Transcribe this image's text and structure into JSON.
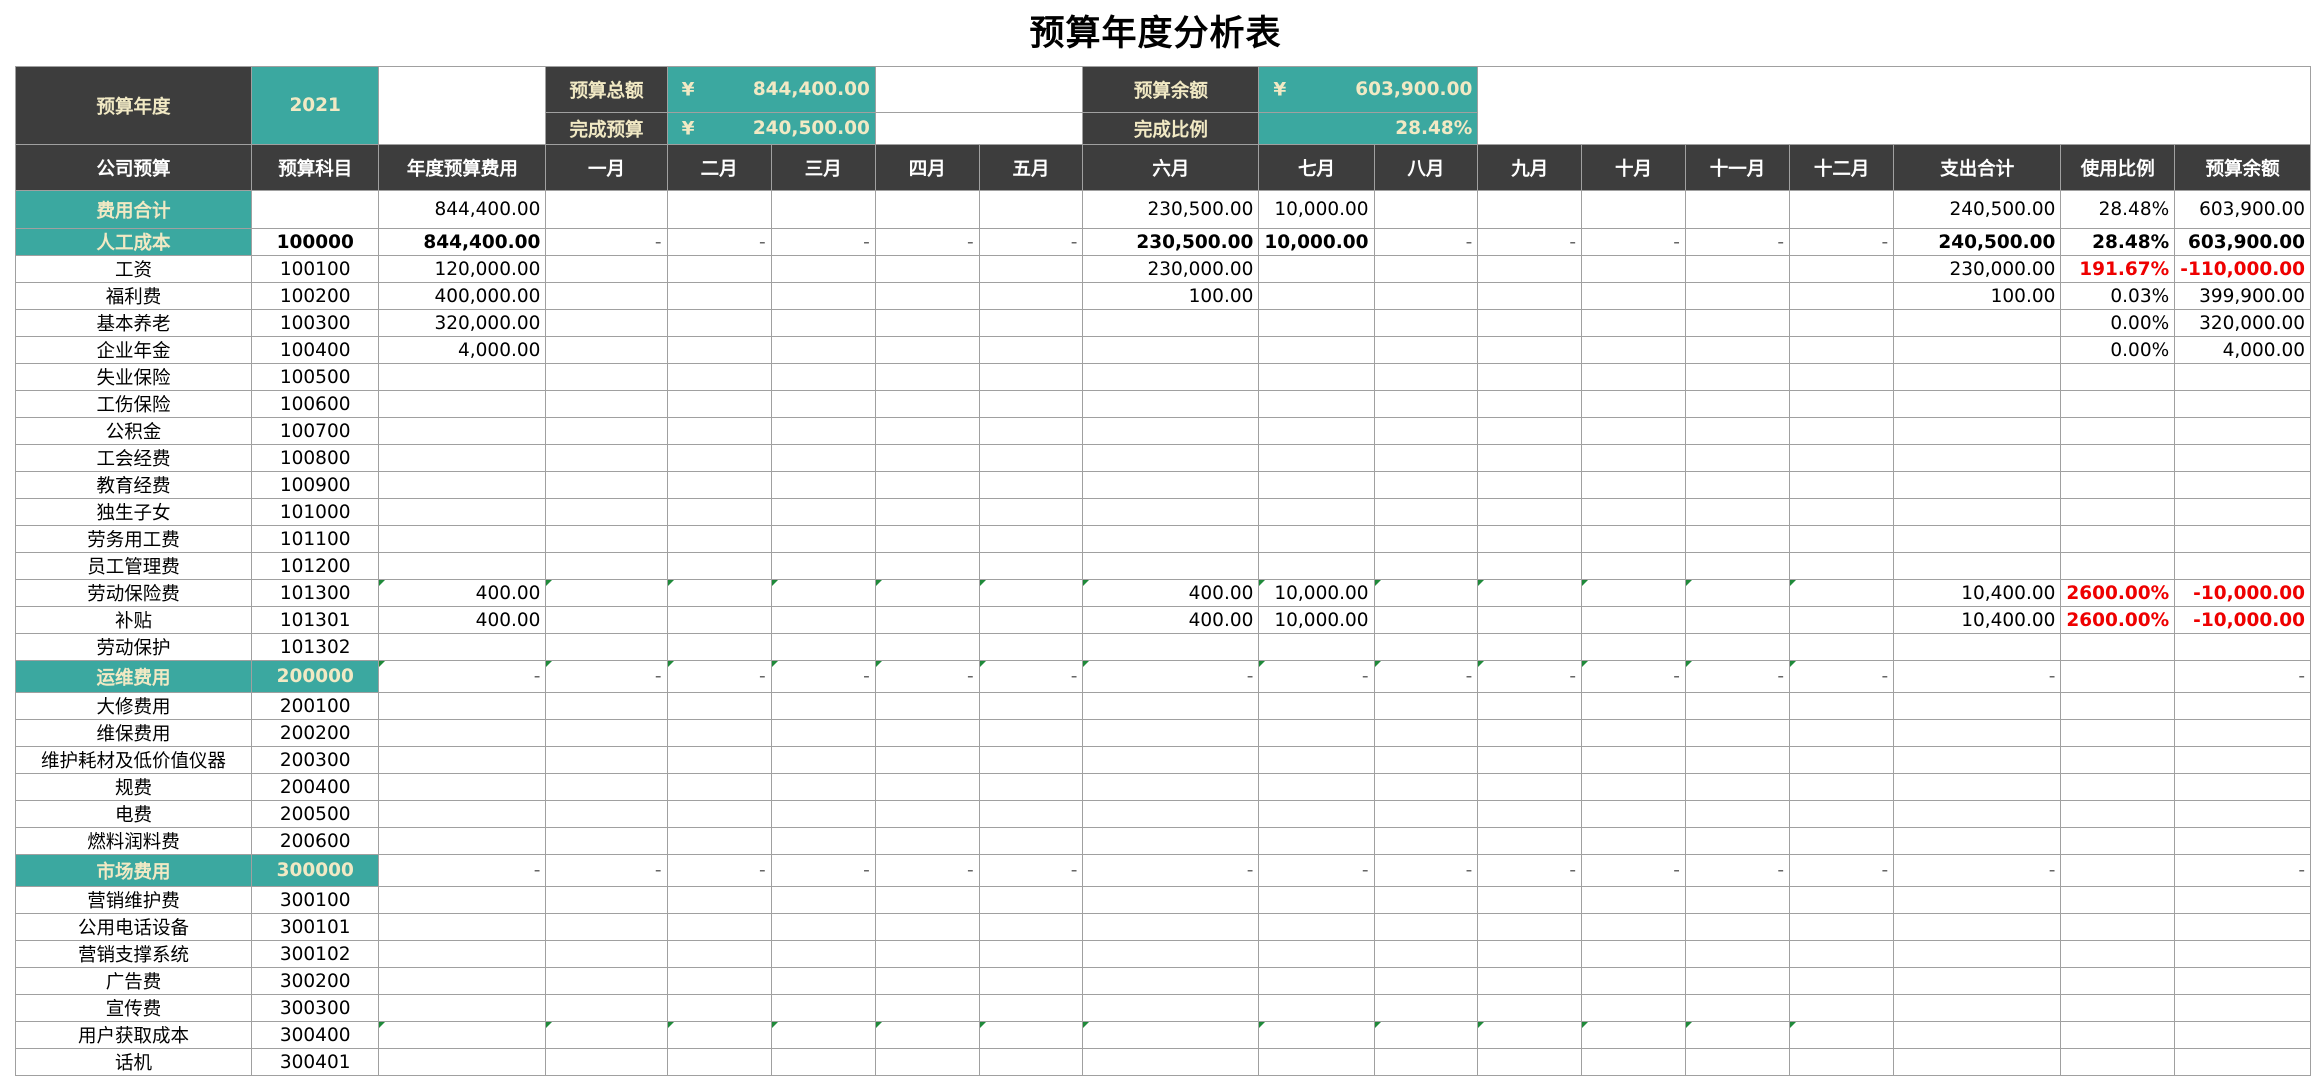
{
  "title": "预算年度分析表",
  "summary": {
    "year_label": "预算年度",
    "year_value": "2021",
    "total_label": "预算总额",
    "total_currency": "¥",
    "total_value": "844,400.00",
    "done_label": "完成预算",
    "done_currency": "¥",
    "done_value": "240,500.00",
    "remain_label": "预算余额",
    "remain_currency": "¥",
    "remain_value": "603,900.00",
    "ratio_label": "完成比例",
    "ratio_value": "28.48%"
  },
  "headers": [
    "公司预算",
    "预算科目",
    "年度预算费用",
    "一月",
    "二月",
    "三月",
    "四月",
    "五月",
    "六月",
    "七月",
    "八月",
    "九月",
    "十月",
    "十一月",
    "十二月",
    "支出合计",
    "使用比例",
    "预算余额"
  ],
  "rows": [
    {
      "type": "group",
      "name": "费用合计",
      "code": "",
      "annual": "844,400.00",
      "m6": "230,500.00",
      "m7": "10,000.00",
      "total": "240,500.00",
      "ratio": "28.48%",
      "remain": "603,900.00"
    },
    {
      "type": "cat",
      "name": "人工成本",
      "code": "100000",
      "annual": "844,400.00",
      "m1": "-",
      "m2": "-",
      "m3": "-",
      "m4": "-",
      "m5": "-",
      "m6": "230,500.00",
      "m7": "10,000.00",
      "m8": "-",
      "m9": "-",
      "m10": "-",
      "m11": "-",
      "m12": "-",
      "total": "240,500.00",
      "ratio": "28.48%",
      "remain": "603,900.00"
    },
    {
      "type": "item",
      "name": "工资",
      "code": "100100",
      "annual": "120,000.00",
      "m6": "230,000.00",
      "total": "230,000.00",
      "ratio": "191.67%",
      "remain": "-110,000.00",
      "neg": true
    },
    {
      "type": "item",
      "name": "福利费",
      "code": "100200",
      "annual": "400,000.00",
      "m6": "100.00",
      "total": "100.00",
      "ratio": "0.03%",
      "remain": "399,900.00"
    },
    {
      "type": "item",
      "name": "基本养老",
      "code": "100300",
      "annual": "320,000.00",
      "ratio": "0.00%",
      "remain": "320,000.00"
    },
    {
      "type": "item",
      "name": "企业年金",
      "code": "100400",
      "annual": "4,000.00",
      "ratio": "0.00%",
      "remain": "4,000.00"
    },
    {
      "type": "item",
      "name": "失业保险",
      "code": "100500"
    },
    {
      "type": "item",
      "name": "工伤保险",
      "code": "100600"
    },
    {
      "type": "item",
      "name": "公积金",
      "code": "100700"
    },
    {
      "type": "item",
      "name": "工会经费",
      "code": "100800"
    },
    {
      "type": "item",
      "name": "教育经费",
      "code": "100900"
    },
    {
      "type": "item",
      "name": "独生子女",
      "code": "101000"
    },
    {
      "type": "item",
      "name": "劳务用工费",
      "code": "101100"
    },
    {
      "type": "item",
      "name": "员工管理费",
      "code": "101200"
    },
    {
      "type": "item",
      "name": "劳动保险费",
      "code": "101300",
      "annual": "400.00",
      "m6": "400.00",
      "m7": "10,000.00",
      "total": "10,400.00",
      "ratio": "2600.00%",
      "remain": "-10,000.00",
      "neg": true,
      "tri": true
    },
    {
      "type": "item",
      "name": "补贴",
      "code": "101301",
      "annual": "400.00",
      "m6": "400.00",
      "m7": "10,000.00",
      "total": "10,400.00",
      "ratio": "2600.00%",
      "remain": "-10,000.00",
      "neg": true
    },
    {
      "type": "item",
      "name": "劳动保护",
      "code": "101302"
    },
    {
      "type": "catteal",
      "name": "运维费用",
      "code": "200000",
      "annual": "-",
      "m1": "-",
      "m2": "-",
      "m3": "-",
      "m4": "-",
      "m5": "-",
      "m6": "-",
      "m7": "-",
      "m8": "-",
      "m9": "-",
      "m10": "-",
      "m11": "-",
      "m12": "-",
      "total": "-",
      "ratio": "",
      "remain": "-",
      "tri": true
    },
    {
      "type": "item",
      "name": "大修费用",
      "code": "200100"
    },
    {
      "type": "item",
      "name": "维保费用",
      "code": "200200"
    },
    {
      "type": "item",
      "name": "维护耗材及低价值仪器",
      "code": "200300"
    },
    {
      "type": "item",
      "name": "规费",
      "code": "200400"
    },
    {
      "type": "item",
      "name": "电费",
      "code": "200500"
    },
    {
      "type": "item",
      "name": "燃料润料费",
      "code": "200600"
    },
    {
      "type": "catteal",
      "name": "市场费用",
      "code": "300000",
      "annual": "-",
      "m1": "-",
      "m2": "-",
      "m3": "-",
      "m4": "-",
      "m5": "-",
      "m6": "-",
      "m7": "-",
      "m8": "-",
      "m9": "-",
      "m10": "-",
      "m11": "-",
      "m12": "-",
      "total": "-",
      "ratio": "",
      "remain": "-",
      "tri": false
    },
    {
      "type": "item",
      "name": "营销维护费",
      "code": "300100"
    },
    {
      "type": "item",
      "name": "公用电话设备",
      "code": "300101"
    },
    {
      "type": "item",
      "name": "营销支撑系统",
      "code": "300102"
    },
    {
      "type": "item",
      "name": "广告费",
      "code": "300200"
    },
    {
      "type": "item",
      "name": "宣传费",
      "code": "300300"
    },
    {
      "type": "item",
      "name": "用户获取成本",
      "code": "300400",
      "tri": true
    },
    {
      "type": "item",
      "name": "话机",
      "code": "300401"
    }
  ]
}
